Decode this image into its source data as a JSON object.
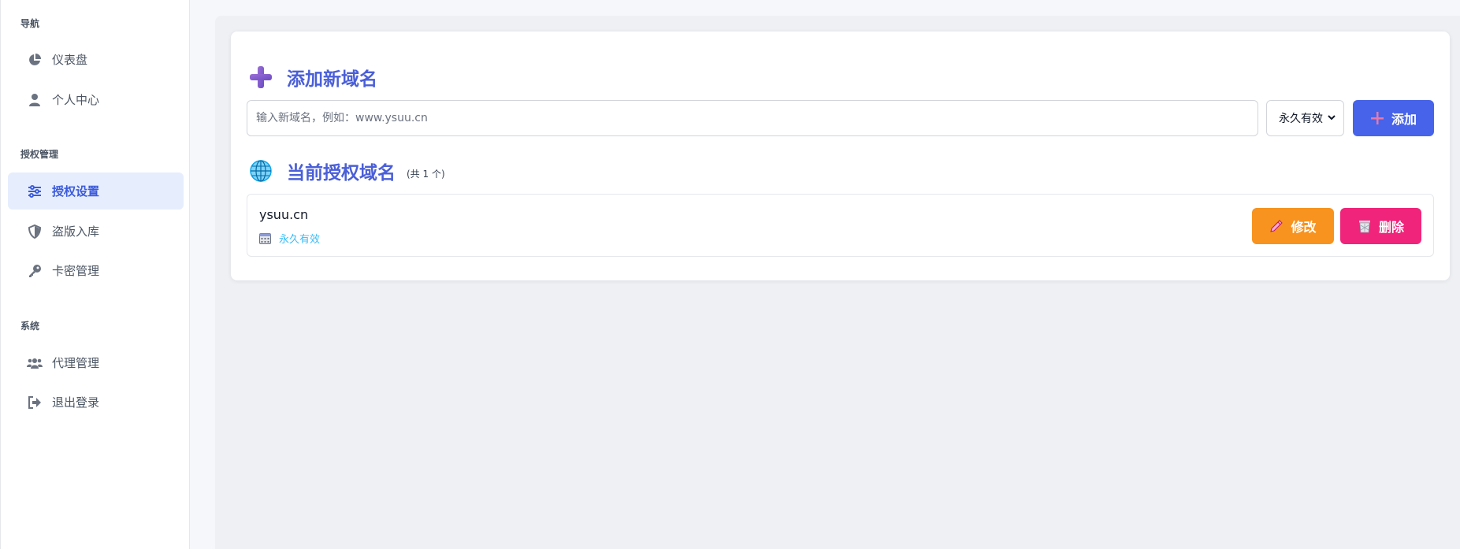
{
  "sidebar": {
    "sections": [
      {
        "title": "导航",
        "items": [
          {
            "label": "仪表盘",
            "icon": "chart-pie-icon"
          },
          {
            "label": "个人中心",
            "icon": "user-icon"
          }
        ]
      },
      {
        "title": "授权管理",
        "items": [
          {
            "label": "授权设置",
            "icon": "sliders-icon",
            "active": true
          },
          {
            "label": "盗版入库",
            "icon": "shield-icon"
          },
          {
            "label": "卡密管理",
            "icon": "key-icon"
          }
        ]
      },
      {
        "title": "系统",
        "items": [
          {
            "label": "代理管理",
            "icon": "users-icon"
          },
          {
            "label": "退出登录",
            "icon": "sign-out-icon"
          }
        ]
      }
    ]
  },
  "add_domain": {
    "title": "添加新域名",
    "input_placeholder": "输入新域名，例如：www.ysuu.cn",
    "input_value": "",
    "duration_selected": "永久有效",
    "add_button_label": "添加"
  },
  "current_domains": {
    "title": "当前授权域名",
    "count_text": "(共 1 个)",
    "items": [
      {
        "domain": "ysuu.cn",
        "expiry": "永久有效",
        "edit_label": "修改",
        "delete_label": "删除"
      }
    ]
  },
  "colors": {
    "primary": "#4763ea",
    "heading": "#4a5fd8",
    "edit": "#f7931e",
    "delete": "#f0247a",
    "active_nav_bg": "#e6edfd",
    "expiry_text": "#38bdf8"
  }
}
